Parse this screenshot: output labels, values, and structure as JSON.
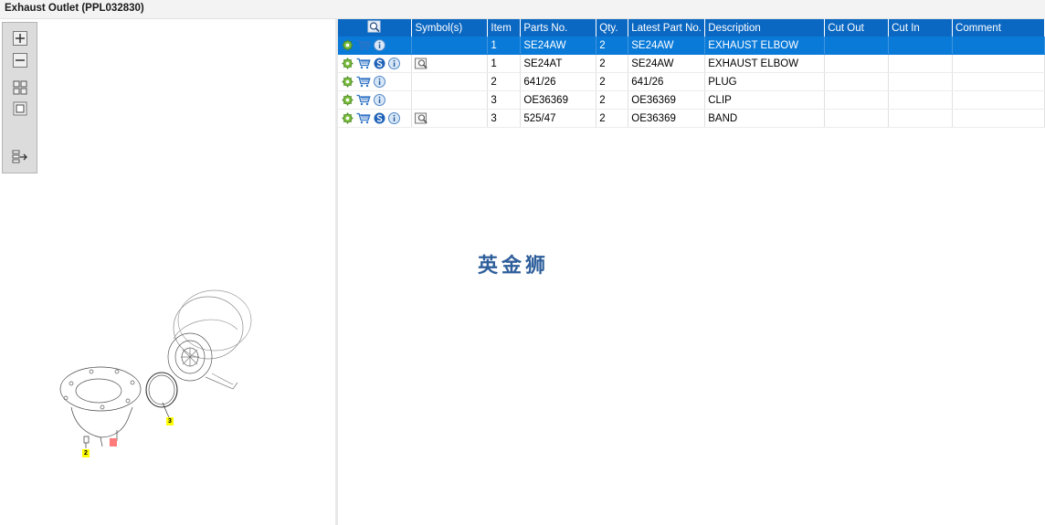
{
  "window": {
    "title": "Exhaust Outlet (PPL032830)"
  },
  "toolbar": {
    "buttons": [
      {
        "name": "zoom-in-button",
        "icon": "zoom-in-icon"
      },
      {
        "name": "zoom-out-button",
        "icon": "zoom-out-icon"
      },
      {
        "name": "fit-all-button",
        "icon": "fit-all-icon"
      },
      {
        "name": "actual-size-button",
        "icon": "actual-size-icon"
      },
      {
        "name": "export-button",
        "icon": "export-icon"
      }
    ]
  },
  "diagram": {
    "callouts": [
      "2",
      "3"
    ]
  },
  "table": {
    "columns": [
      "",
      "Symbol(s)",
      "Item",
      "Parts No.",
      "Qty.",
      "Latest Part No.",
      "Description",
      "Cut Out",
      "Cut In",
      "Comment"
    ],
    "rows": [
      {
        "item": "1",
        "part_no": "SE24AW",
        "qty": "2",
        "latest_part_no": "SE24AW",
        "description": "EXHAUST ELBOW",
        "cut_out": "",
        "cut_in": "",
        "comment": "",
        "selected": true,
        "service_icon": false,
        "symbol_icon": false
      },
      {
        "item": "1",
        "part_no": "SE24AT",
        "qty": "2",
        "latest_part_no": "SE24AW",
        "description": "EXHAUST ELBOW",
        "cut_out": "",
        "cut_in": "",
        "comment": "",
        "selected": false,
        "service_icon": true,
        "symbol_icon": true
      },
      {
        "item": "2",
        "part_no": "641/26",
        "qty": "2",
        "latest_part_no": "641/26",
        "description": "PLUG",
        "cut_out": "",
        "cut_in": "",
        "comment": "",
        "selected": false,
        "service_icon": false,
        "symbol_icon": false
      },
      {
        "item": "3",
        "part_no": "OE36369",
        "qty": "2",
        "latest_part_no": "OE36369",
        "description": "CLIP",
        "cut_out": "",
        "cut_in": "",
        "comment": "",
        "selected": false,
        "service_icon": false,
        "symbol_icon": false
      },
      {
        "item": "3",
        "part_no": "525/47",
        "qty": "2",
        "latest_part_no": "OE36369",
        "description": "BAND",
        "cut_out": "",
        "cut_in": "",
        "comment": "",
        "selected": false,
        "service_icon": true,
        "symbol_icon": true
      }
    ]
  },
  "watermark": "英金狮",
  "colors": {
    "header": "#0b68c2",
    "selected_row": "#0a7ad8",
    "callout": "#ffff00"
  }
}
